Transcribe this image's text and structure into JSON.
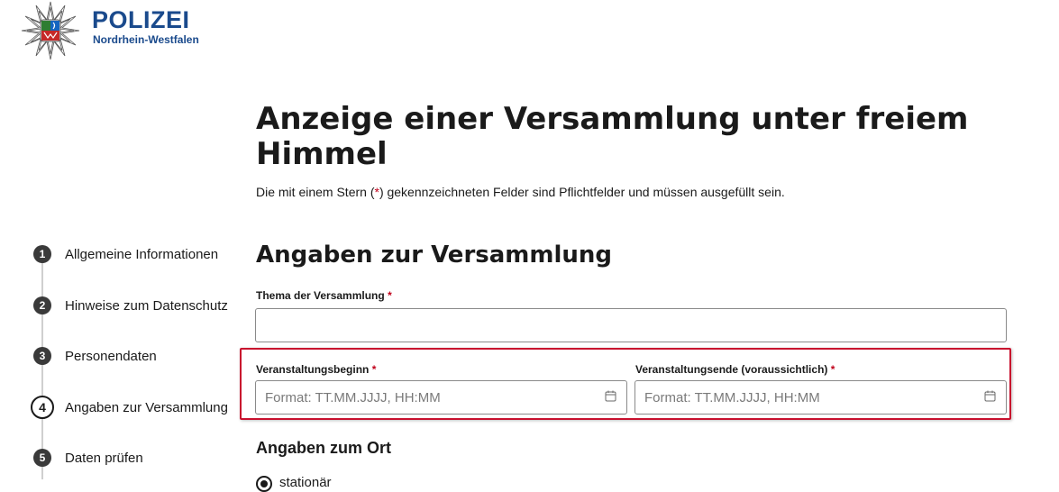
{
  "header": {
    "logo_title": "POLIZEI",
    "logo_subtitle": "Nordrhein-Westfalen"
  },
  "page": {
    "title": "Anzeige einer Versammlung unter freiem Himmel",
    "hint_before": "Die mit einem Stern (",
    "hint_star": "*",
    "hint_after": ") gekennzeichneten Felder sind Pflichtfelder und müssen ausgefüllt sein."
  },
  "stepper": {
    "steps": [
      {
        "number": "1",
        "label": "Allgemeine Informationen"
      },
      {
        "number": "2",
        "label": "Hinweise zum Datenschutz"
      },
      {
        "number": "3",
        "label": "Personendaten"
      },
      {
        "number": "4",
        "label": "Angaben zur Versammlung",
        "active": true
      },
      {
        "number": "5",
        "label": "Daten prüfen"
      }
    ]
  },
  "form": {
    "section_title": "Angaben zur Versammlung",
    "required_marker": "*",
    "thema": {
      "label": "Thema der Versammlung",
      "value": "",
      "placeholder": ""
    },
    "beginn": {
      "label": "Veranstaltungsbeginn",
      "value": "",
      "placeholder": "Format: TT.MM.JJJJ, HH:MM"
    },
    "ende": {
      "label": "Veranstaltungsende (voraussichtlich)",
      "value": "",
      "placeholder": "Format: TT.MM.JJJJ, HH:MM"
    },
    "ort_title": "Angaben zum Ort",
    "ort_option": {
      "label": "stationär",
      "selected": true
    }
  },
  "icons": {
    "logo": "police-star-icon",
    "date": "calendar-icon"
  },
  "colors": {
    "brand_blue": "#1a4a8c",
    "required_red": "#c0001a",
    "highlight_red": "#c8102e",
    "step_dark": "#3a3a3a"
  }
}
